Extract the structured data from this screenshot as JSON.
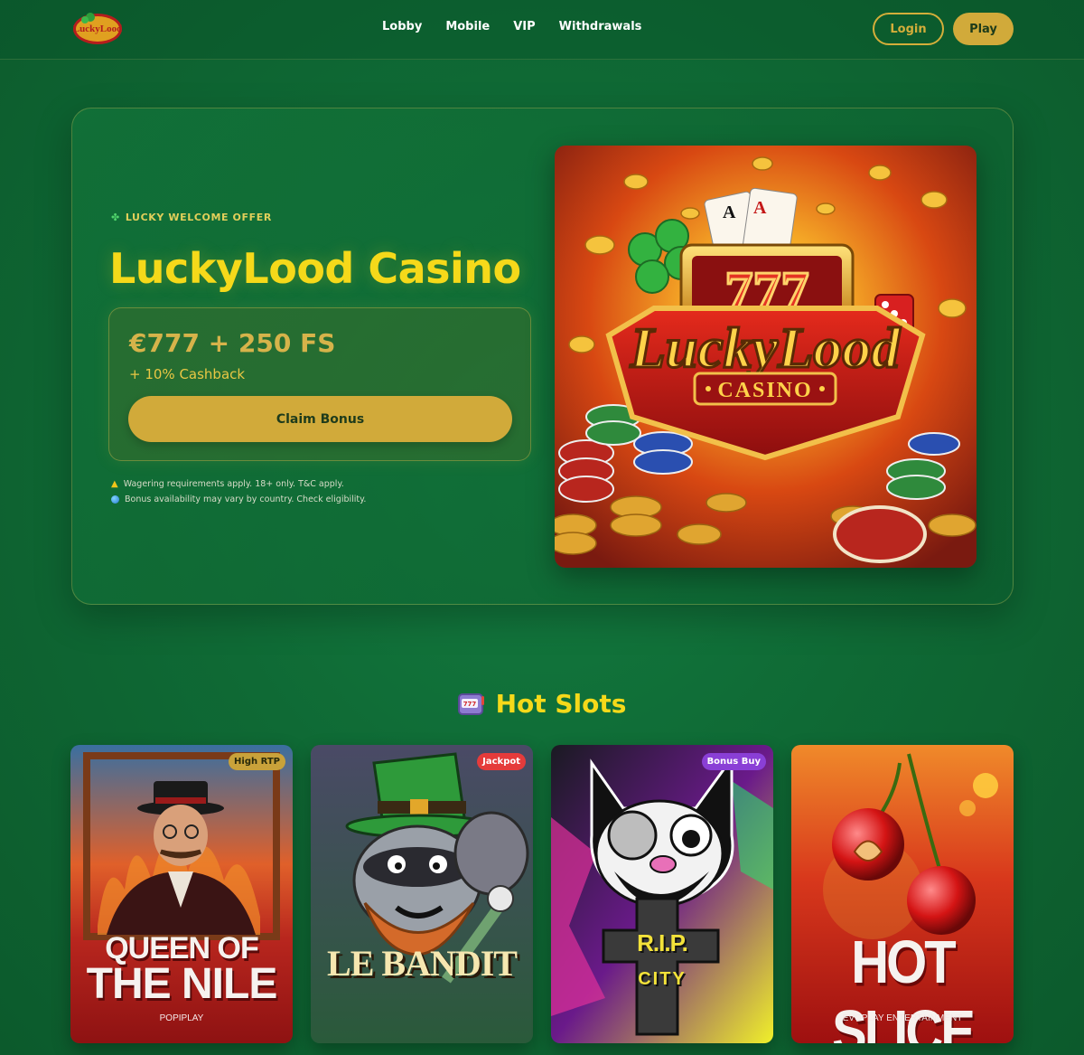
{
  "header": {
    "logo_text": "LuckyLood",
    "nav": [
      "Lobby",
      "Mobile",
      "VIP",
      "Withdrawals"
    ],
    "login_label": "Login",
    "play_label": "Play"
  },
  "hero": {
    "tag": "LUCKY WELCOME OFFER",
    "title": "LuckyLood Casino",
    "bonus_amount": "€777 + 250 FS",
    "bonus_cashback": "+ 10% Cashback",
    "claim_label": "Claim Bonus",
    "disclaimers": [
      "Wagering requirements apply. 18+ only. T&C apply.",
      "Bonus availability may vary by country. Check eligibility."
    ],
    "image_text": {
      "numbers": "777",
      "brand": "LuckyLood",
      "sub": "CASINO"
    }
  },
  "hot_slots": {
    "title": "Hot Slots",
    "games": [
      {
        "title_line1": "QUEEN OF",
        "title_line2": "THE NILE",
        "provider": "POPIPLAY",
        "badge": "High RTP",
        "badge_color": "#c9a23a"
      },
      {
        "title_line1": "LE BANDIT",
        "title_line2": "",
        "provider": "",
        "badge": "Jackpot",
        "badge_color": "#e53b3b"
      },
      {
        "title_line1": "R.I.P.",
        "title_line2": "CITY",
        "provider": "",
        "badge": "Bonus Buy",
        "badge_color": "#8a3fd6"
      },
      {
        "title_line1": "HOT SLICE",
        "title_line2": "",
        "provider": "EVOPLAY ENTERTAINMENT",
        "badge": "",
        "badge_color": ""
      }
    ]
  },
  "colors": {
    "accent_gold": "#d1aa3a",
    "title_yellow": "#f5d91a",
    "background_green": "#0f6a35"
  }
}
